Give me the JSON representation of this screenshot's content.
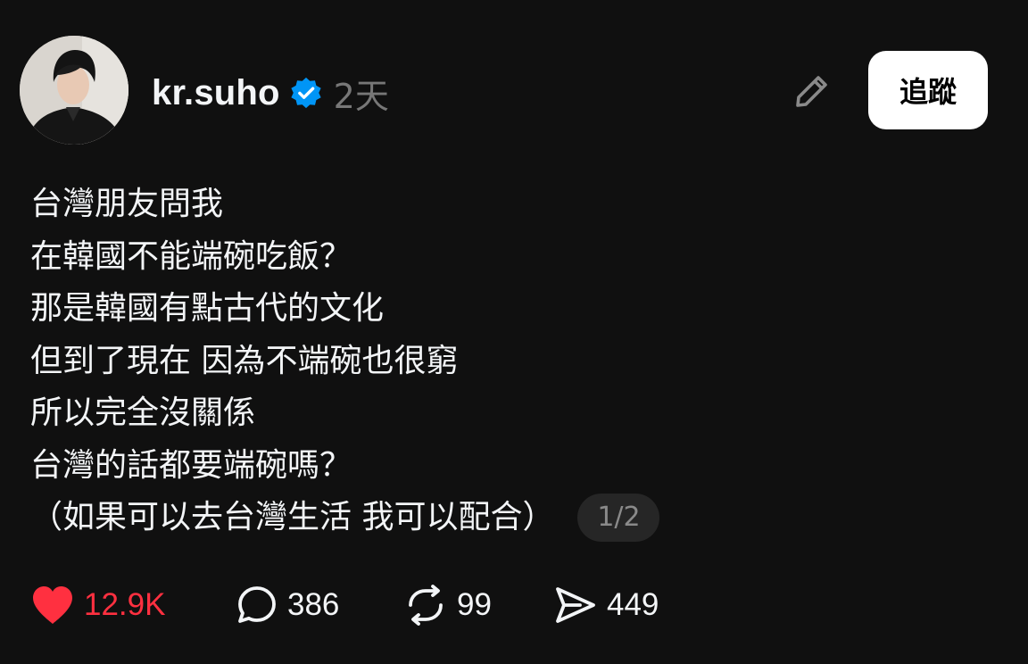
{
  "post": {
    "author": {
      "username": "kr.suho",
      "verified": true,
      "timestamp": "2天",
      "avatar_icon": "profile-photo"
    },
    "follow_label": "追蹤",
    "edit_icon": "pencil-icon",
    "lines": [
      "台灣朋友問我",
      "在韓國不能端碗吃飯？",
      "那是韓國有點古代的文化",
      "但到了現在 因為不端碗也很窮",
      "所以完全沒關係",
      "台灣的話都要端碗嗎？",
      "（如果可以去台灣生活 我可以配合）"
    ],
    "page_indicator": "1/2",
    "actions": {
      "likes": "12.9K",
      "replies": "386",
      "reposts": "99",
      "shares": "449"
    }
  },
  "colors": {
    "background": "#101010",
    "text": "#f3f5f7",
    "muted": "#777777",
    "like": "#ff3040",
    "verified": "#0095f6",
    "follow_bg": "#ffffff"
  }
}
